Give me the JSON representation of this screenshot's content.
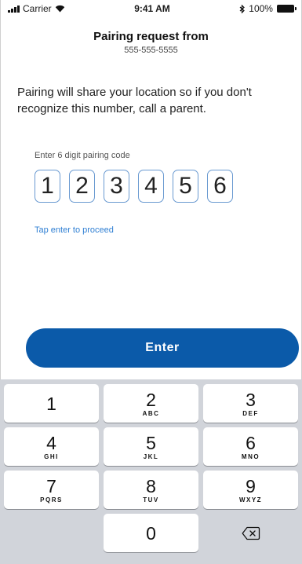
{
  "status_bar": {
    "carrier": "Carrier",
    "time": "9:41 AM",
    "battery": "100%"
  },
  "header": {
    "title": "Pairing request from",
    "subtitle": "555-555-5555"
  },
  "message": "Pairing will share your location so if you don't recognize this number, call a parent.",
  "code": {
    "label": "Enter 6 digit pairing code",
    "digits": [
      "1",
      "2",
      "3",
      "4",
      "5",
      "6"
    ],
    "hint": "Tap enter to proceed"
  },
  "enter_button": {
    "label": "Enter",
    "color": "#0b5aa9"
  },
  "keypad": {
    "keys": [
      {
        "digit": "1",
        "letters": ""
      },
      {
        "digit": "2",
        "letters": "ABC"
      },
      {
        "digit": "3",
        "letters": "DEF"
      },
      {
        "digit": "4",
        "letters": "GHI"
      },
      {
        "digit": "5",
        "letters": "JKL"
      },
      {
        "digit": "6",
        "letters": "MNO"
      },
      {
        "digit": "7",
        "letters": "PQRS"
      },
      {
        "digit": "8",
        "letters": "TUV"
      },
      {
        "digit": "9",
        "letters": "WXYZ"
      },
      {
        "digit": "0",
        "letters": ""
      }
    ],
    "delete_icon": "backspace-icon"
  }
}
